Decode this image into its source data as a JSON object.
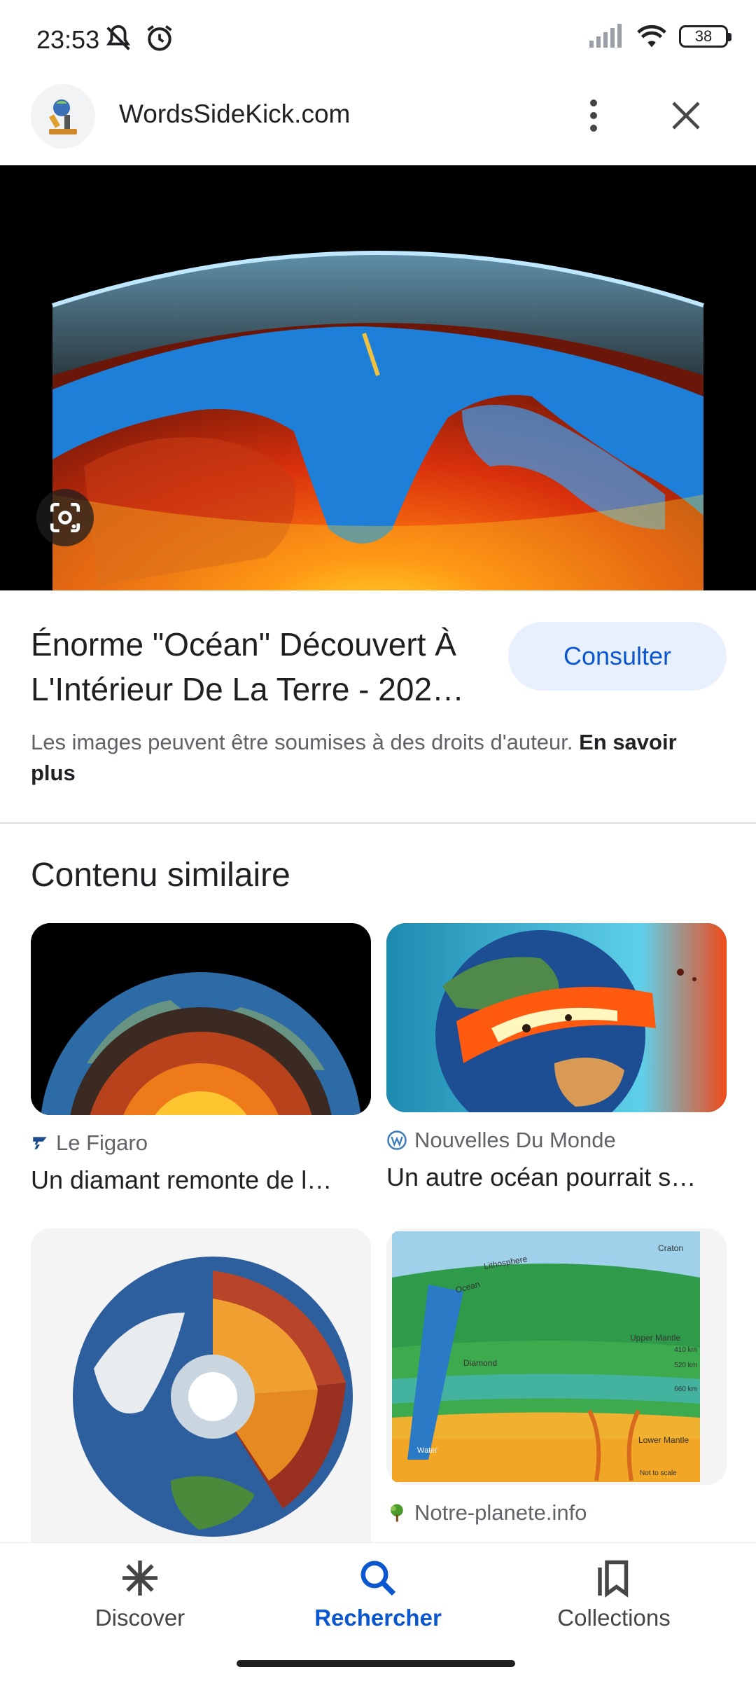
{
  "status_bar": {
    "time": "23:53",
    "icons": [
      "mute-icon",
      "alarm-icon",
      "signal-icon",
      "wifi-icon"
    ],
    "battery": "38"
  },
  "header": {
    "site": "WordsSideKick.com",
    "logo_icon": "microscope-icon",
    "more_icon": "more-vert-icon",
    "close_icon": "close-icon"
  },
  "hero": {
    "lens_icon": "google-lens-icon"
  },
  "result": {
    "title": "Énorme \"Océan\" Découvert À L'Intérieur De La Terre - 202…",
    "consult_label": "Consulter",
    "copyright_text": "Les images peuvent être soumises à des droits d'auteur. ",
    "learn_more": "En savoir plus"
  },
  "similar": {
    "heading": "Contenu similaire",
    "cards": [
      {
        "source": "Le Figaro",
        "title": "Un diamant remonte de l…"
      },
      {
        "source": "Nouvelles Du Monde",
        "title": "Un autre océan pourrait s…"
      },
      {
        "source": "",
        "title": ""
      },
      {
        "source": "Notre-planete.info",
        "title": ""
      }
    ],
    "diagram_labels": [
      "Craton",
      "Lithosphere",
      "Ocean",
      "Diamond",
      "Upper Mantle",
      "410 km",
      "520 km",
      "660 km",
      "Lower Mantle",
      "Not to scale",
      "Water"
    ]
  },
  "nav": {
    "items": [
      {
        "label": "Discover",
        "icon": "discover-icon"
      },
      {
        "label": "Rechercher",
        "icon": "search-icon"
      },
      {
        "label": "Collections",
        "icon": "collections-icon"
      }
    ],
    "active_color": "#0b57d0"
  }
}
